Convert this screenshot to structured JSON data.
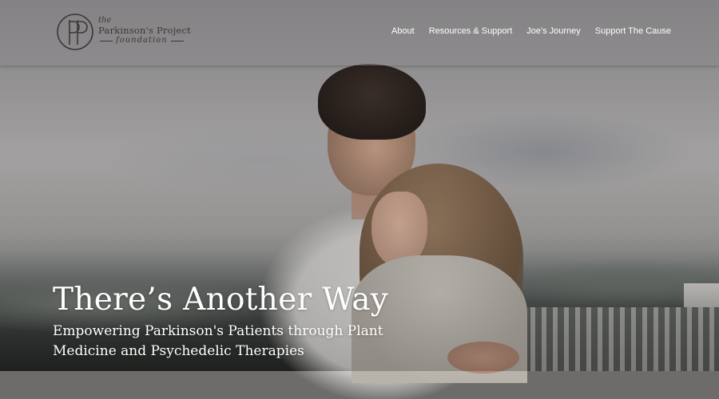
{
  "header": {
    "logo": {
      "icon": "pp-monogram-icon",
      "line1": "the",
      "line2": "Parkinson's Project",
      "line3": "foundation"
    },
    "nav": [
      {
        "label": "About"
      },
      {
        "label": "Resources & Support"
      },
      {
        "label": "Joe's Journey"
      },
      {
        "label": "Support The Cause"
      }
    ]
  },
  "hero": {
    "title": "There’s Another Way",
    "subtitle": "Empowering Parkinson's Patients through Plant Medicine and Psychedelic Therapies",
    "image_alt": "couple-embracing-photo"
  },
  "colors": {
    "header_bg": "#8c8a8c",
    "logo_text": "#3b3838",
    "nav_text": "#ffffff",
    "hero_text": "#ffffff"
  }
}
